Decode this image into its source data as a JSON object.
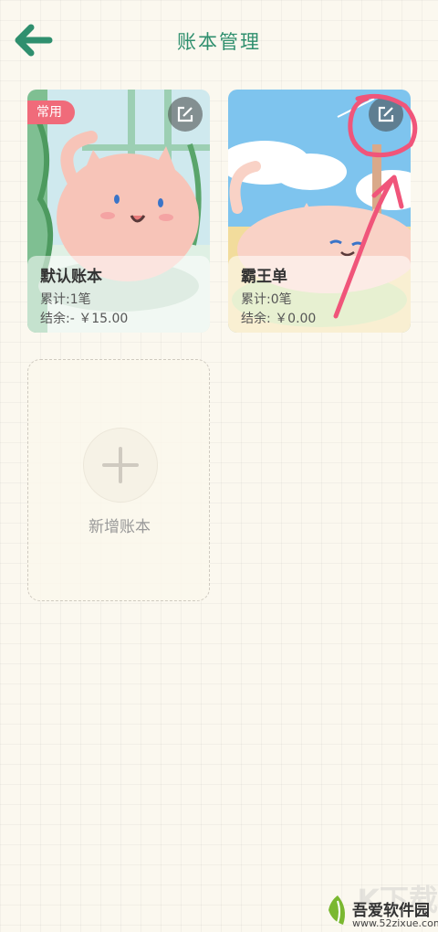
{
  "header": {
    "title": "账本管理",
    "back_icon": "back-arrow-icon"
  },
  "books": [
    {
      "name": "默认账本",
      "tag": "常用",
      "count": "累计:1笔",
      "balance": "结余:- ￥15.00",
      "edit_icon": "edit-icon"
    },
    {
      "name": "霸王单",
      "count": "累计:0笔",
      "balance": "结余: ￥0.00",
      "edit_icon": "edit-icon"
    }
  ],
  "add_book": {
    "label": "新增账本",
    "icon": "plus-icon"
  },
  "watermark": {
    "big_text": "K下载",
    "name": "吾爱软件园",
    "url": "www.52zixue.com"
  },
  "colors": {
    "accent": "#2f8f6e",
    "tag": "#f06b7a",
    "annotation": "#f0557a"
  }
}
